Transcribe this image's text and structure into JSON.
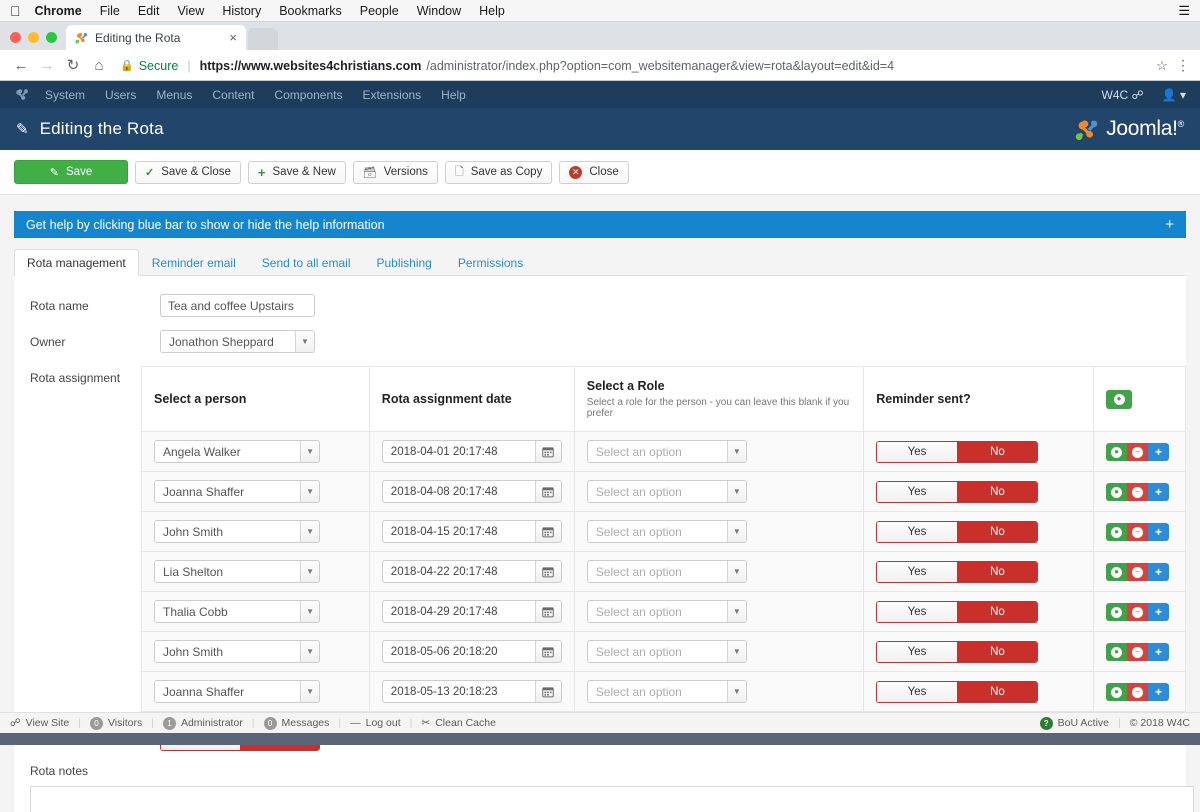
{
  "os_menu": {
    "apple_icon": "apple-icon",
    "items": [
      "Chrome",
      "File",
      "Edit",
      "View",
      "History",
      "Bookmarks",
      "People",
      "Window",
      "Help"
    ],
    "right_icon": "list-icon"
  },
  "browser": {
    "tab": {
      "title": "Editing the Rota",
      "favicon": "joomla-favicon",
      "close": "×"
    },
    "nav": {
      "back": "←",
      "forward": "→",
      "reload": "↻",
      "home": "⌂"
    },
    "address": {
      "lock_icon": "lock-icon",
      "secure_label": "Secure",
      "url_host": "https://www.websites4christians.com",
      "url_path": "/administrator/index.php?option=com_websitemanager&view=rota&layout=edit&id=4"
    },
    "star_icon": "star-icon",
    "menu_icon": "kebab-menu-icon"
  },
  "joomla": {
    "topmenu": {
      "logo": "joomla-mark",
      "items": [
        "System",
        "Users",
        "Menus",
        "Content",
        "Components",
        "Extensions",
        "Help"
      ],
      "site_label": "W4C",
      "site_icon": "external-link-icon",
      "user_icon": "user-icon"
    },
    "header": {
      "icon": "pencil-icon",
      "title": "Editing the Rota",
      "brand": "Joomla!",
      "brand_sup": "®"
    },
    "toolbar": [
      {
        "label": "Save",
        "icon": "save-icon",
        "style": "primary"
      },
      {
        "label": "Save & Close",
        "icon": "check-icon",
        "style": "default"
      },
      {
        "label": "Save & New",
        "icon": "plus-icon",
        "style": "default"
      },
      {
        "label": "Versions",
        "icon": "archive-icon",
        "style": "default"
      },
      {
        "label": "Save as Copy",
        "icon": "copy-icon",
        "style": "default"
      },
      {
        "label": "Close",
        "icon": "close-circle-icon",
        "style": "default"
      }
    ],
    "helpbar": {
      "text": "Get help by clicking blue bar to show or hide the help information",
      "toggle": "+"
    },
    "tabs": [
      {
        "label": "Rota management",
        "active": true
      },
      {
        "label": "Reminder email",
        "active": false
      },
      {
        "label": "Send to all email",
        "active": false
      },
      {
        "label": "Publishing",
        "active": false
      },
      {
        "label": "Permissions",
        "active": false
      }
    ]
  },
  "form": {
    "rota_name": {
      "label": "Rota name",
      "value": "Tea and coffee Upstairs"
    },
    "owner": {
      "label": "Owner",
      "value": "Jonathon Sheppard"
    },
    "rota_assignment_label": "Rota assignment",
    "reminder_sent": {
      "label": "Reminder sent?",
      "yes": "Yes",
      "no": "No",
      "selected": "No"
    },
    "rota_notes": {
      "label": "Rota notes",
      "value": ""
    }
  },
  "table": {
    "headers": {
      "person": "Select a person",
      "date": "Rota assignment date",
      "role": "Select a Role",
      "role_sub": "Select a role for the person - you can leave this blank if you prefer",
      "reminder": "Reminder sent?",
      "add_icon": "add-row-icon"
    },
    "role_placeholder": "Select an option",
    "yes_label": "Yes",
    "no_label": "No",
    "row_actions": {
      "move": "move-icon",
      "remove": "remove-row-icon",
      "add": "add-row-icon"
    },
    "rows": [
      {
        "person": "Angela Walker",
        "date": "2018-04-01 20:17:48",
        "role": "",
        "reminder": "No"
      },
      {
        "person": "Joanna Shaffer",
        "date": "2018-04-08 20:17:48",
        "role": "",
        "reminder": "No"
      },
      {
        "person": "John Smith",
        "date": "2018-04-15 20:17:48",
        "role": "",
        "reminder": "No"
      },
      {
        "person": "Lia Shelton",
        "date": "2018-04-22 20:17:48",
        "role": "",
        "reminder": "No"
      },
      {
        "person": "Thalia Cobb",
        "date": "2018-04-29 20:17:48",
        "role": "",
        "reminder": "No"
      },
      {
        "person": "John Smith",
        "date": "2018-05-06 20:18:20",
        "role": "",
        "reminder": "No"
      },
      {
        "person": "Joanna Shaffer",
        "date": "2018-05-13 20:18:23",
        "role": "",
        "reminder": "No"
      }
    ]
  },
  "statusbar": {
    "view_site": "View Site",
    "visitors": {
      "count": "0",
      "label": "Visitors"
    },
    "administrator": {
      "count": "1",
      "label": "Administrator"
    },
    "messages": {
      "count": "0",
      "label": "Messages"
    },
    "logout": "Log out",
    "clean_cache": "Clean Cache",
    "bou": "BoU Active",
    "copyright": "© 2018 W4C"
  },
  "colors": {
    "accent_blue": "#1586cd",
    "joomla_dark": "#1c3d5c",
    "joomla_header": "#22456b",
    "save_green": "#3faf46",
    "danger_red": "#c9302c",
    "action_green": "#41a24a",
    "action_red": "#d9413c",
    "action_blue": "#2e8bd8"
  }
}
